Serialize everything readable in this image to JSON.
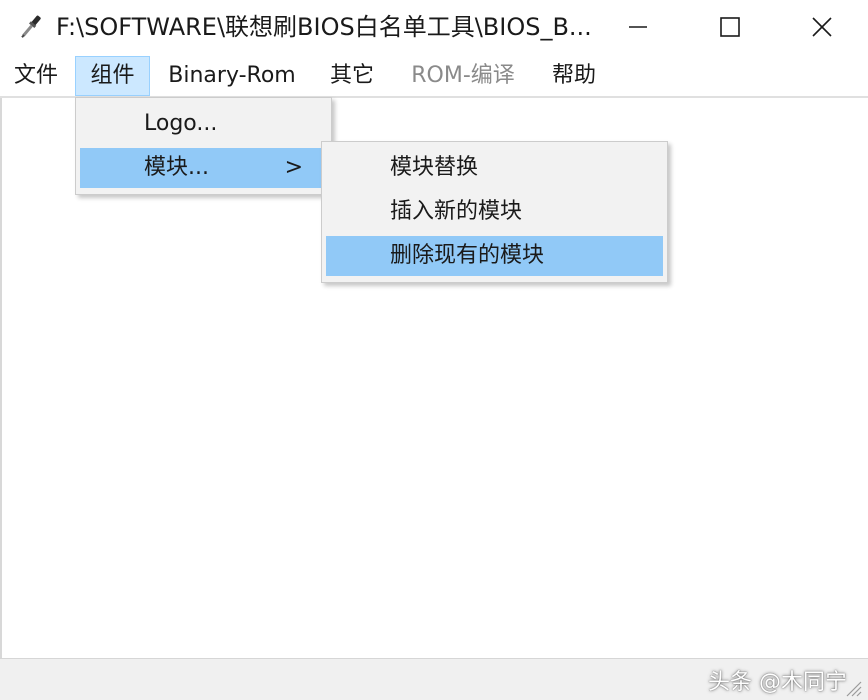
{
  "window": {
    "title": "F:\\SOFTWARE\\联想刷BIOS白名单工具\\BIOS_B...",
    "icons": {
      "app": "screwdriver-icon",
      "minimize": "minimize-icon",
      "maximize": "maximize-icon",
      "close": "close-icon"
    }
  },
  "menubar": {
    "items": [
      {
        "label": "文件"
      },
      {
        "label": "组件",
        "state": "open"
      },
      {
        "label": "Binary-Rom"
      },
      {
        "label": "其它"
      },
      {
        "label": "ROM-编译",
        "state": "disabled"
      },
      {
        "label": "帮助"
      }
    ]
  },
  "component_menu": {
    "items": [
      {
        "label": "Logo..."
      },
      {
        "label": "模块...",
        "arrow": ">",
        "highlighted": true
      }
    ]
  },
  "module_submenu": {
    "items": [
      {
        "label": "模块替换"
      },
      {
        "label": "插入新的模块"
      },
      {
        "label": "删除现有的模块",
        "highlighted": true
      }
    ]
  },
  "watermark": {
    "text": "头条 @木同宁"
  },
  "colors": {
    "menu_highlight": "#91c9f7",
    "menubar_open": "#cce8ff",
    "menu_background": "#f2f2f2",
    "disabled_text": "#8a8a8a"
  }
}
